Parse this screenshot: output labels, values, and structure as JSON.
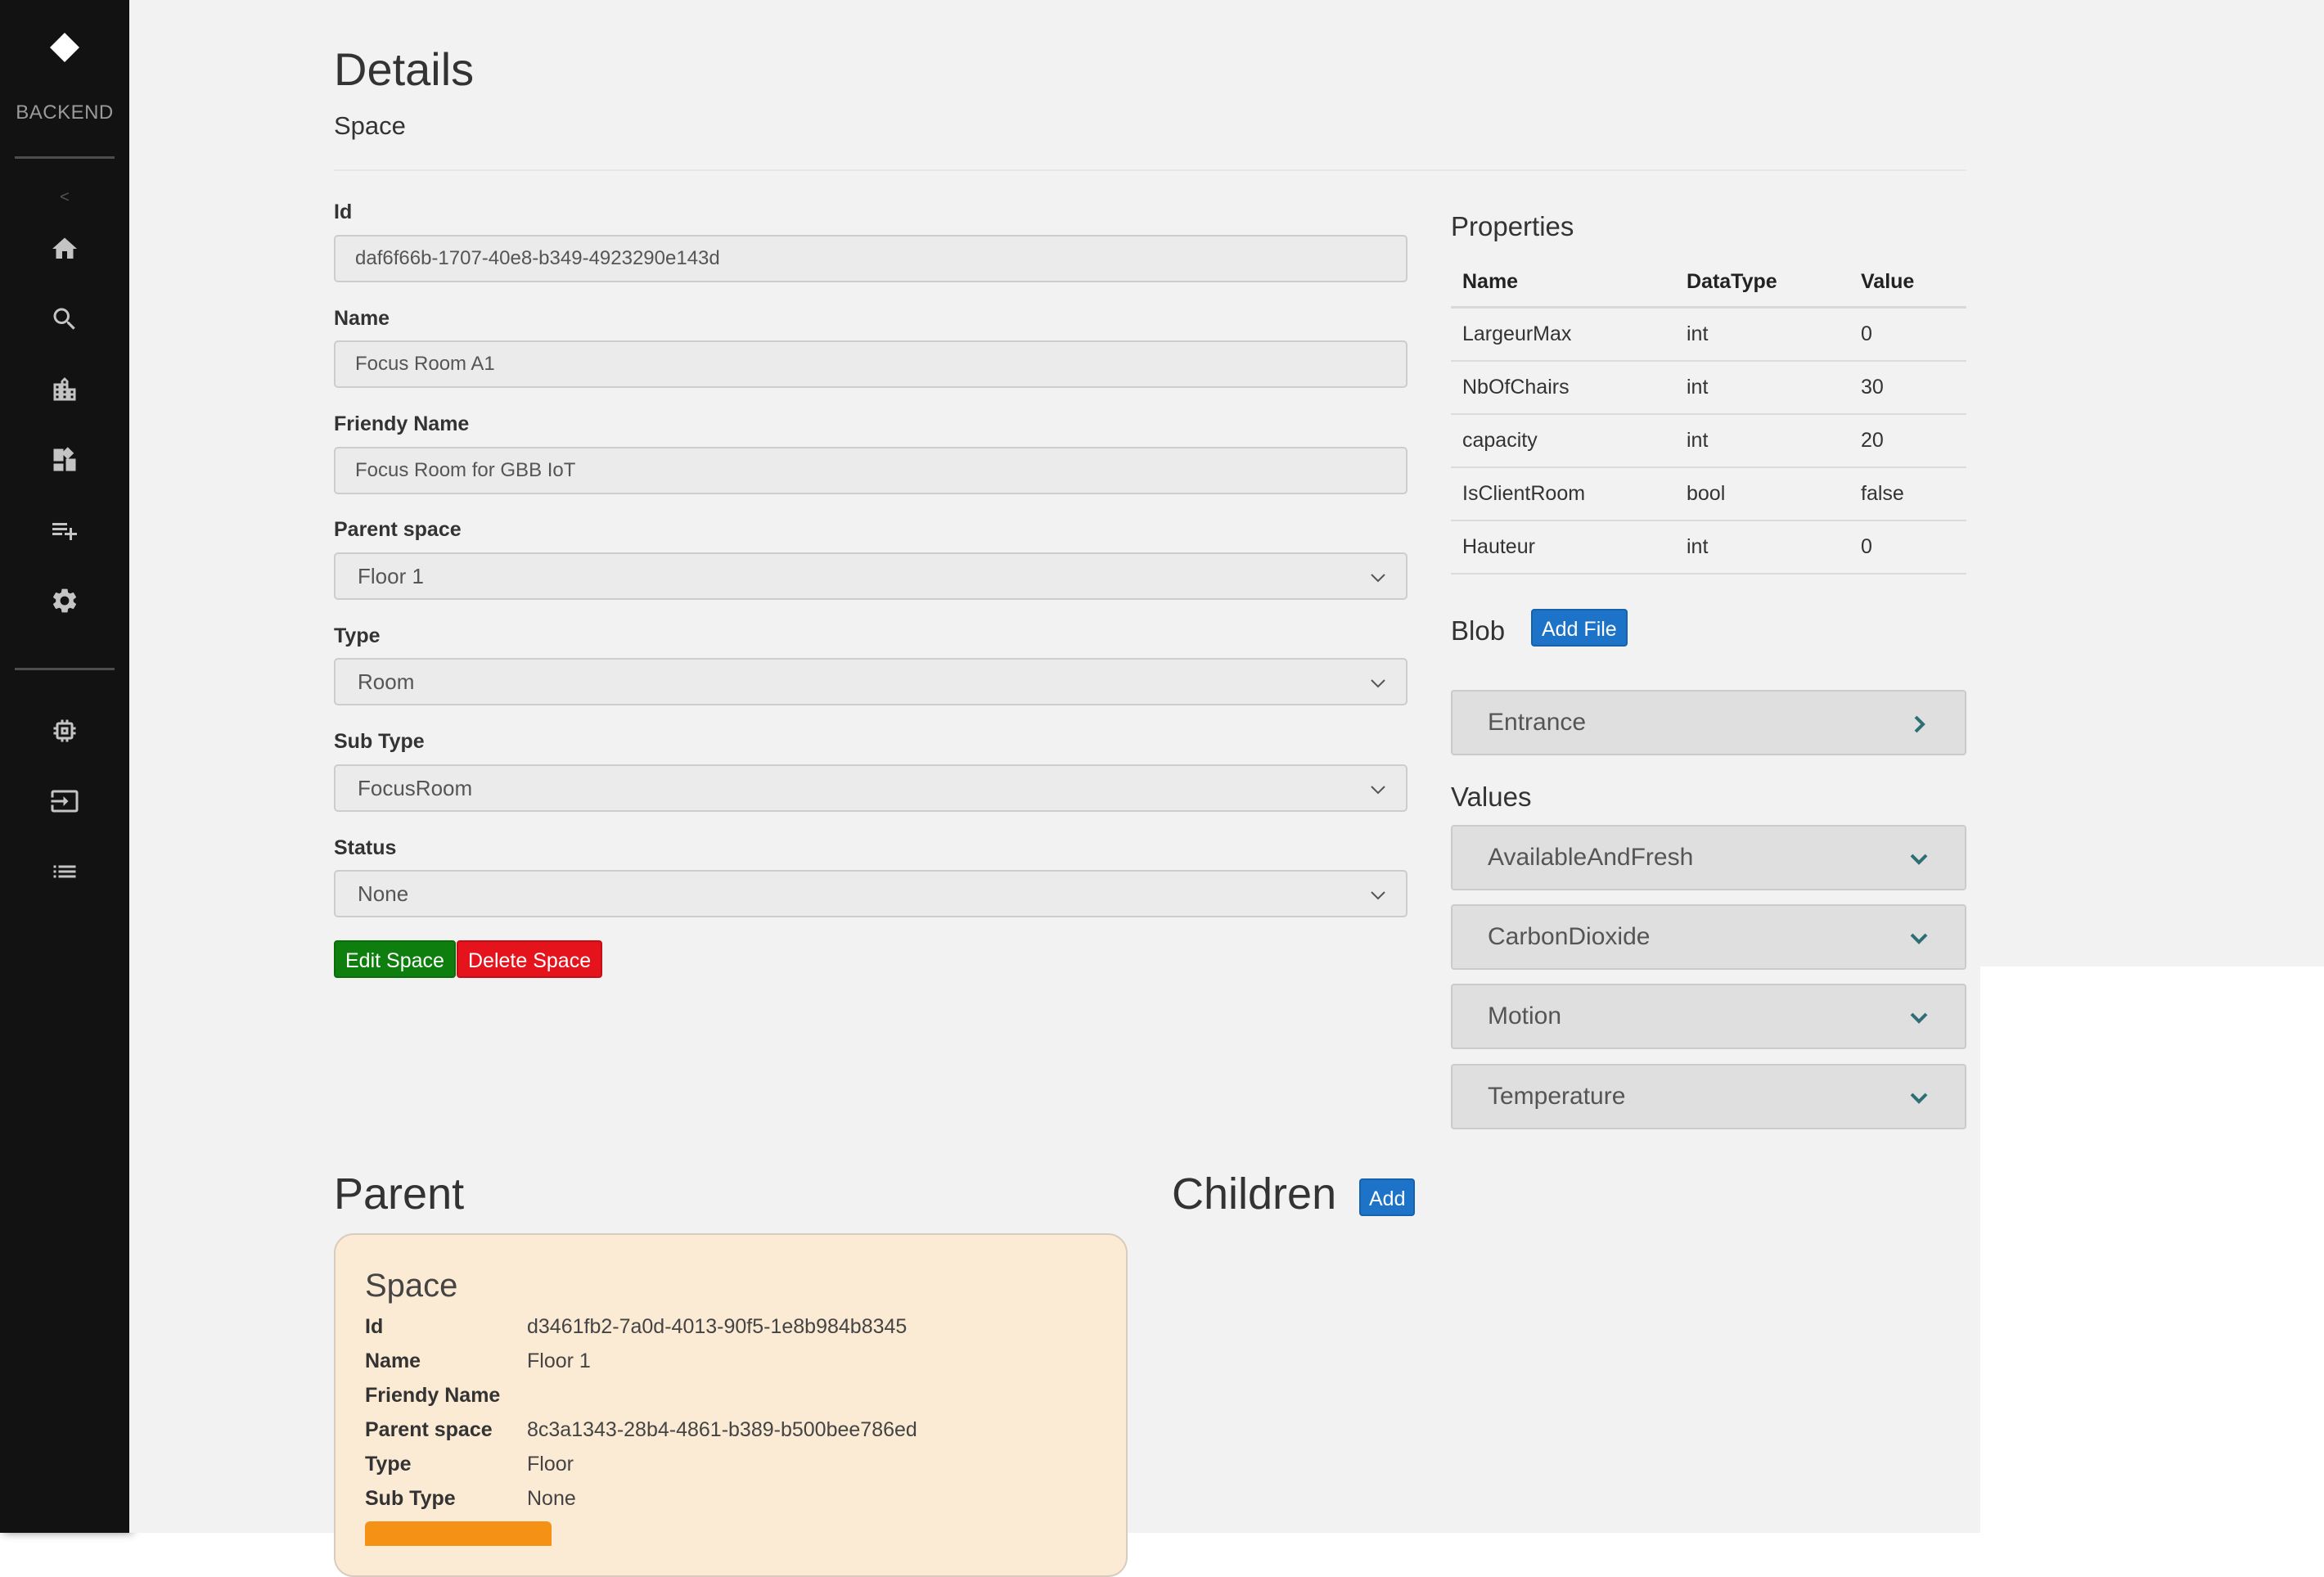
{
  "sidebar": {
    "brand": "BACKEND",
    "collapse_label": "<",
    "icons": [
      "home-icon",
      "search-icon",
      "buildings-icon",
      "dashboard-icon",
      "playlist-add-icon",
      "settings-icon",
      "chip-icon",
      "input-icon",
      "list-icon"
    ]
  },
  "header": {
    "title": "Details",
    "subtitle": "Space"
  },
  "form": {
    "id_label": "Id",
    "id_value": "daf6f66b-1707-40e8-b349-4923290e143d",
    "name_label": "Name",
    "name_value": "Focus Room A1",
    "friendly_label": "Friendy Name",
    "friendly_value": "Focus Room for GBB IoT",
    "parent_label": "Parent space",
    "parent_value": "Floor 1",
    "type_label": "Type",
    "type_value": "Room",
    "subtype_label": "Sub Type",
    "subtype_value": "FocusRoom",
    "status_label": "Status",
    "status_value": "None",
    "edit_button": "Edit Space",
    "delete_button": "Delete Space"
  },
  "properties": {
    "title": "Properties",
    "headers": [
      "Name",
      "DataType",
      "Value"
    ],
    "rows": [
      [
        "LargeurMax",
        "int",
        "0"
      ],
      [
        "NbOfChairs",
        "int",
        "30"
      ],
      [
        "capacity",
        "int",
        "20"
      ],
      [
        "IsClientRoom",
        "bool",
        "false"
      ],
      [
        "Hauteur",
        "int",
        "0"
      ]
    ]
  },
  "blob": {
    "title": "Blob",
    "add_button": "Add File",
    "items": [
      "Entrance"
    ]
  },
  "values": {
    "title": "Values",
    "items": [
      "AvailableAndFresh",
      "CarbonDioxide",
      "Motion",
      "Temperature"
    ]
  },
  "parent": {
    "title": "Parent",
    "card_title": "Space",
    "id_label": "Id",
    "id_value": "d3461fb2-7a0d-4013-90f5-1e8b984b8345",
    "name_label": "Name",
    "name_value": "Floor 1",
    "friendly_label": "Friendy Name",
    "friendly_value": "",
    "parent_label": "Parent space",
    "parent_value": "8c3a1343-28b4-4861-b389-b500bee786ed",
    "type_label": "Type",
    "type_value": "Floor",
    "subtype_label": "Sub Type",
    "subtype_value": "None"
  },
  "children": {
    "title": "Children",
    "add_button": "Add"
  },
  "colors": {
    "sidebar_bg": "#121212",
    "main_bg": "#f2f2f2",
    "edit_green": "#0e7f0e",
    "delete_red": "#e5131c",
    "action_blue": "#1c73c7",
    "card_bg": "#fbead4",
    "chevron_teal": "#2d6f74"
  }
}
